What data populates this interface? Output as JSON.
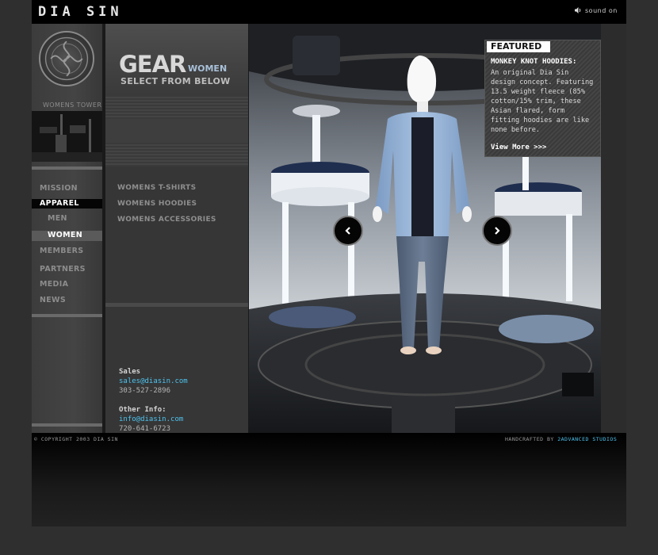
{
  "header": {
    "logo": "DIA SIN",
    "sound_label": "sound on"
  },
  "sidebar": {
    "tower_label": "WOMENS TOWER",
    "nav": {
      "mission": "MISSION",
      "apparel": "APPAREL",
      "men": "MEN",
      "women": "WOMEN",
      "members": "MEMBERS",
      "partners": "PARTNERS",
      "media": "MEDIA",
      "news": "NEWS"
    }
  },
  "section": {
    "title": "GEAR",
    "subtitle": "WOMEN",
    "instruction": "SELECT FROM BELOW",
    "items": [
      "WOMENS T-SHIRTS",
      "WOMENS HOODIES",
      "WOMENS ACCESSORIES"
    ]
  },
  "contact": {
    "sales_label": "Sales",
    "sales_email": "sales@diasin.com",
    "sales_phone": "303-527-2896",
    "other_label": "Other Info:",
    "other_email": "info@diasin.com",
    "other_phone": "720-641-6723"
  },
  "featured": {
    "tag": "FEATURED",
    "title": "MONKEY KNOT HOODIES:",
    "body": "An original Dia Sin design concept.  Featuring 13.5 weight fleece (85% cotton/15% trim, these Asian flared, form fitting hoodies are like none before.",
    "more": "View More >>>"
  },
  "footer": {
    "copyright": "© COPYRIGHT 2003 DIA SIN",
    "handcrafted_prefix": "HANDCRAFTED BY ",
    "studio": "2ADVANCED STUDIOS"
  },
  "colors": {
    "accent_blue": "#4ec3ee",
    "subtitle_blue": "#a9c1d9"
  }
}
